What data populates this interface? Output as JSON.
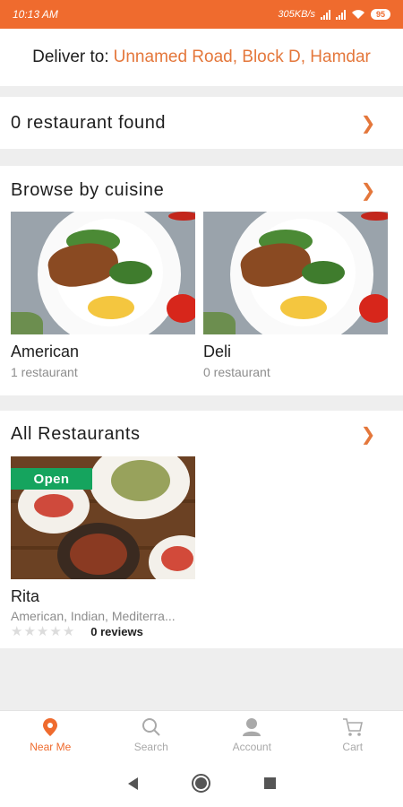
{
  "status_bar": {
    "time": "10:13 AM",
    "network_speed": "305KB/s",
    "battery": "95"
  },
  "header": {
    "deliver_label": "Deliver to:",
    "address": "Unnamed Road, Block D, Hamdar"
  },
  "results": {
    "text": "0 restaurant found",
    "icon": "chevron-right-icon"
  },
  "cuisine_section": {
    "title": "Browse by cuisine",
    "items": [
      {
        "name": "American",
        "count": "1 restaurant"
      },
      {
        "name": "Deli",
        "count": "0 restaurant"
      }
    ]
  },
  "restaurants_section": {
    "title": "All Restaurants",
    "items": [
      {
        "name": "Rita",
        "status": "Open",
        "cuisines": "American, Indian, Mediterra...",
        "rating": 0,
        "reviews": "0 reviews"
      }
    ]
  },
  "bottom_nav": [
    {
      "label": "Near Me",
      "icon": "location-pin-icon",
      "active": true
    },
    {
      "label": "Search",
      "icon": "search-icon",
      "active": false
    },
    {
      "label": "Account",
      "icon": "account-icon",
      "active": false
    },
    {
      "label": "Cart",
      "icon": "cart-icon",
      "active": false
    }
  ],
  "colors": {
    "accent": "#ef6b2e",
    "open_badge": "#15a45e"
  }
}
